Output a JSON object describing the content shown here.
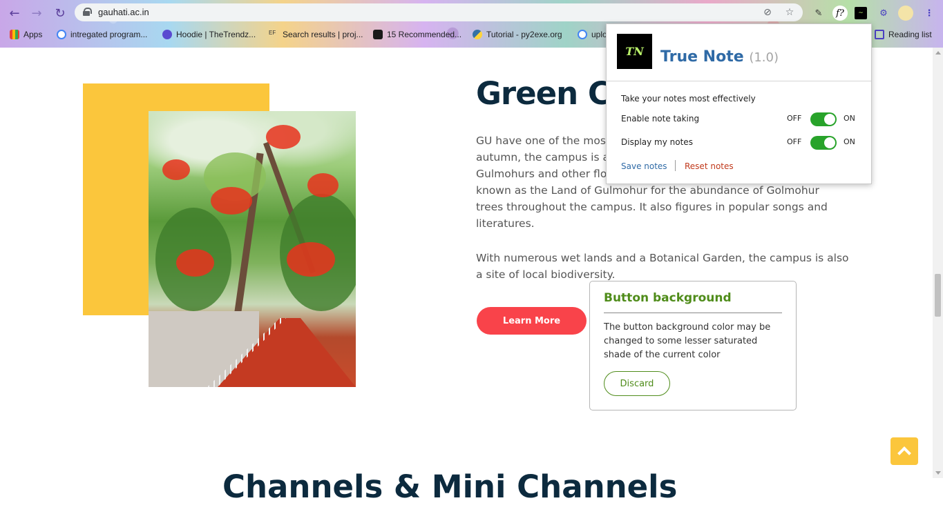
{
  "browser": {
    "url": "gauhati.ac.in",
    "bookmarks": [
      {
        "label": "Apps",
        "icon": "apps-grid-icon"
      },
      {
        "label": "intregated program...",
        "icon": "google-icon"
      },
      {
        "label": "Hoodie | TheTrendz...",
        "icon": "globe-icon"
      },
      {
        "label": "Search results | proj...",
        "icon": "ef-icon"
      },
      {
        "label": "15 Recommended...",
        "icon": "bookmark-icon"
      },
      {
        "label": "Tutorial - py2exe.org",
        "icon": "python-icon"
      },
      {
        "label": "uplo",
        "icon": "google-icon"
      }
    ],
    "reading_list": "Reading list"
  },
  "page": {
    "heading": "Green C",
    "paragraph1": "GU have one of the most beautiful campuses. During spring and autumn, the campus is adorned with red flowers of the blooming Gulmohurs and other flowering trees. The university is also famously known as the Land of Gulmohur for the abundance of Golmohur trees throughout the campus. It also figures in popular songs and literatures.",
    "paragraph2": "With numerous wet lands and a Botanical Garden, the campus is also a site of local biodiversity.",
    "learn_more": "Learn More",
    "bottom_heading": "Channels & Mini Channels"
  },
  "note_card": {
    "title": "Button background",
    "body": "The button background color may be changed to some lesser saturated shade of the current color",
    "discard": "Discard"
  },
  "popup": {
    "logo_text": "TN",
    "title": "True Note",
    "version": "(1.0)",
    "tagline": "Take your notes most effectively",
    "rows": [
      {
        "label": "Enable note taking",
        "off": "OFF",
        "on": "ON",
        "enabled": true
      },
      {
        "label": "Display my notes",
        "off": "OFF",
        "on": "ON",
        "enabled": true
      }
    ],
    "save": "Save notes",
    "reset": "Reset notes"
  },
  "colors": {
    "accent_yellow": "#fbc63c",
    "button_red": "#f9434a",
    "toggle_green": "#28a32a",
    "note_green": "#4f8c1a",
    "title_blue": "#2f6aa6"
  }
}
